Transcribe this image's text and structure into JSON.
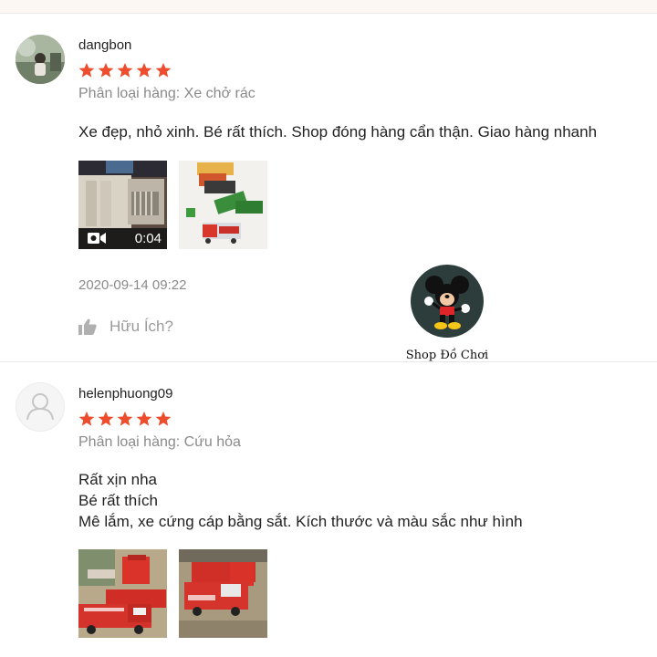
{
  "colors": {
    "star": "#ee4d2d",
    "muted": "#8a8a8a",
    "shop_logo_bg": "#2c3d3b"
  },
  "reviews": [
    {
      "username": "dangbon",
      "rating": 5,
      "variation": "Phân loại hàng: Xe chở rác",
      "comment_lines": [
        "Xe đẹp, nhỏ xinh. Bé rất thích. Shop đóng hàng cẩn thận. Giao hàng nhanh"
      ],
      "media": [
        {
          "type": "video",
          "duration": "0:04",
          "icon": "video-camera-icon"
        },
        {
          "type": "image"
        }
      ],
      "date": "2020-09-14 09:22",
      "helpful_label": "Hữu Ích?"
    },
    {
      "username": "helenphuong09",
      "rating": 5,
      "variation": "Phân loại hàng: Cứu hỏa",
      "comment_lines": [
        "Rất xịn nha",
        "Bé rất thích",
        "Mê lắm, xe cứng cáp bằng sắt. Kích thước và màu sắc như hình"
      ],
      "media": [
        {
          "type": "image"
        },
        {
          "type": "image"
        }
      ]
    }
  ],
  "shop": {
    "name": "Shop Đồ Chơi",
    "logo_icon": "mickey-mouse-icon"
  }
}
